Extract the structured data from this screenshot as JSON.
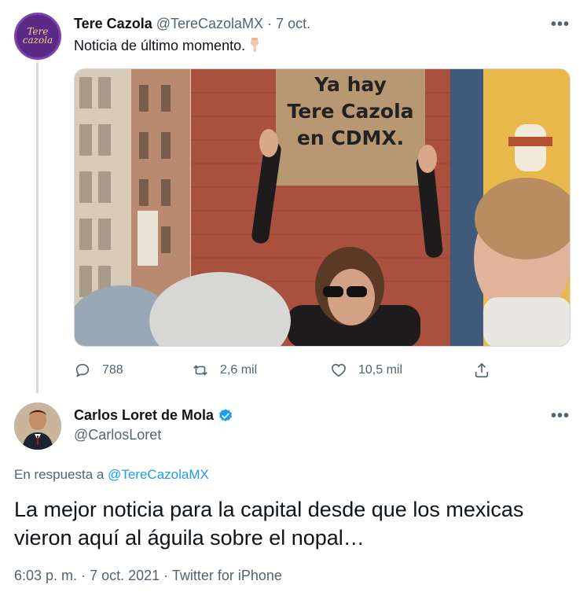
{
  "tweet1": {
    "author_name": "Tere Cazola",
    "handle": "@TereCazolaMX",
    "separator": "·",
    "date": "7 oct.",
    "more": "•••",
    "text": "Noticia de último momento.",
    "avatar_logo_line1": "Tere",
    "avatar_logo_line2": "cazola",
    "image": {
      "sign_line1": "Ya hay",
      "sign_line2": "Tere Cazola",
      "sign_line3": "en CDMX."
    },
    "actions": {
      "replies": "788",
      "retweets": "2,6 mil",
      "likes": "10,5 mil"
    }
  },
  "tweet2": {
    "author_name": "Carlos Loret de Mola",
    "handle": "@CarlosLoret",
    "more": "•••",
    "reply_prefix": "En respuesta a",
    "reply_handle": "@TereCazolaMX",
    "text": "La mejor noticia para la capital desde que los mexicas vieron aquí al águila sobre el nopal…",
    "time": "6:03 p. m.",
    "date": "7 oct. 2021",
    "source": "Twitter for iPhone",
    "meta_separator": "·"
  },
  "colors": {
    "text": "#0f1419",
    "muted": "#536471",
    "link": "#1d9bf0",
    "verified": "#1d9bf0",
    "thread_line": "#cfd9de"
  }
}
